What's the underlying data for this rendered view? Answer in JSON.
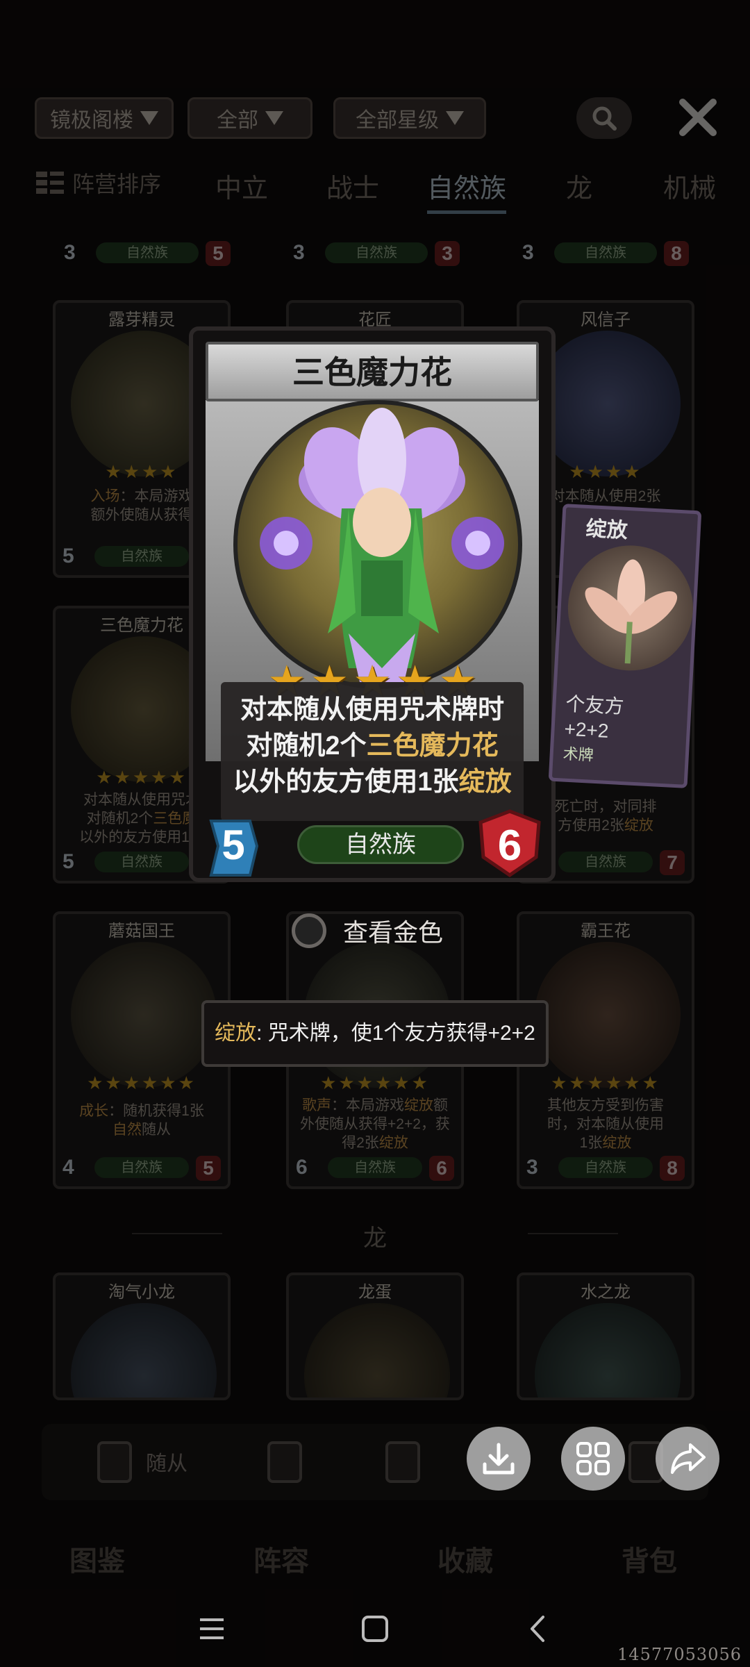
{
  "filters": {
    "pool": "镜极阁楼",
    "category": "全部",
    "stars": "全部星级"
  },
  "faction_tabs": {
    "sort": "阵营排序",
    "items": [
      "中立",
      "战士",
      "自然族",
      "龙",
      "机械"
    ],
    "active_index": 2
  },
  "top_row_partial": [
    {
      "cost": "3",
      "faction": "自然族",
      "power": "5"
    },
    {
      "cost": "3",
      "faction": "自然族",
      "power": "3"
    },
    {
      "cost": "3",
      "faction": "自然族",
      "power": "8"
    }
  ],
  "row1": [
    {
      "name": "露芽精灵",
      "stars": "★★★★",
      "desc1": "入场",
      "desc1b": "：本局游戏",
      "desc2": "额外使随从获得",
      "cost": "5",
      "faction": "自然族",
      "power": ""
    },
    {
      "name": "花匠",
      "stars": "",
      "desc1": "",
      "desc1b": "",
      "desc2": "",
      "cost": "",
      "faction": "",
      "power": ""
    },
    {
      "name": "风信子",
      "stars": "★★★★",
      "desc1": "对本随从使用2张",
      "desc1b": "",
      "desc2": "",
      "cost": "",
      "faction": "",
      "power": ""
    }
  ],
  "row2": [
    {
      "name": "三色魔力花",
      "stars": "★★★★★",
      "desc1": "对本随从使用咒术",
      "desc2a": "对随机2个",
      "desc2b": "三色魔",
      "desc3": "以外的友方使用1张",
      "cost": "5",
      "faction": "自然族"
    },
    {
      "name": "",
      "desc_a": "死亡时，对同排",
      "desc_b": "方使用2张",
      "desc_b_kw": "绽放",
      "faction": "自然族",
      "power": "7"
    }
  ],
  "row3": [
    {
      "name": "蘑菇国王",
      "stars": "★★★★★★",
      "desc1": "成长",
      "desc1b": "：随机获得1张",
      "desc2": "自然",
      "desc2b": "随从",
      "cost": "4",
      "faction": "自然族",
      "power": "5"
    },
    {
      "name": "",
      "stars": "★★★★★★",
      "desc1": "歌声",
      "desc1b": "：本局游戏",
      "desc1c": "绽放",
      "desc1d": "额",
      "desc2": "外使随从获得+2+2，获",
      "desc3": "得2张",
      "desc3b": "绽放",
      "cost": "6",
      "faction": "自然族",
      "power": "6"
    },
    {
      "name": "霸王花",
      "stars": "★★★★★★",
      "desc1": "其他友方受到伤害",
      "desc2": "时，对本随从使用",
      "desc3": "1张",
      "desc3b": "绽放",
      "cost": "3",
      "faction": "自然族",
      "power": "8"
    }
  ],
  "section_dragon": "龙",
  "row4": [
    {
      "name": "淘气小龙"
    },
    {
      "name": "龙蛋"
    },
    {
      "name": "水之龙"
    }
  ],
  "type_bar": {
    "follower": "随从"
  },
  "main_tabs": [
    "图鉴",
    "阵容",
    "收藏",
    "背包"
  ],
  "popup": {
    "name": "三色魔力花",
    "star_count": 5,
    "desc_line1": "对本随从使用咒术牌时",
    "desc_line2_pre": "对随机2个",
    "desc_line2_kw": "三色魔力花",
    "desc_line3_pre": "以外的友方使用1张",
    "desc_line3_kw": "绽放",
    "cost": "5",
    "faction": "自然族",
    "power": "6"
  },
  "side_card": {
    "name": "绽放",
    "desc1": "个友方",
    "desc2": "+2+2",
    "tag": "术牌"
  },
  "view_gold_label": "查看金色",
  "tooltip": {
    "keyword": "绽放",
    "text": ": 咒术牌，使1个友方获得+2+2"
  },
  "watermark": "14577053056",
  "colors": {
    "gold_keyword": "#e5b95b",
    "star": "#e6a51e",
    "cost_blue": "#2f80b8",
    "power_red": "#c2262e",
    "faction_green": "#1e4419"
  }
}
